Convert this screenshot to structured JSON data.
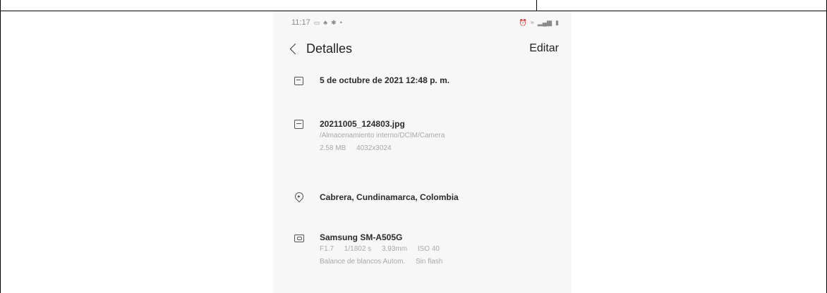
{
  "status_bar": {
    "time": "11:17",
    "left_icons": [
      "screenshot-icon",
      "notification-icon",
      "vpn-icon",
      "dot-icon"
    ],
    "right_icons": [
      "alarm-icon",
      "wifi-icon",
      "signal-icon",
      "battery-icon"
    ]
  },
  "header": {
    "title": "Detalles",
    "edit_label": "Editar"
  },
  "details": {
    "date": "5 de octubre de 2021 12:48 p. m.",
    "file_name": "20211005_124803.jpg",
    "file_path": "/Almacenamiento interno/DCIM/Camera",
    "file_size": "2.58 MB",
    "resolution": "4032x3024",
    "location": "Cabrera, Cundinamarca, Colombia",
    "device": "Samsung SM-A505G",
    "aperture": "F1.7",
    "shutter": "1/1802 s",
    "focal_length": "3.93mm",
    "iso": "ISO 40",
    "white_balance": "Balance de blancos Autom.",
    "flash": "Sin flash"
  }
}
